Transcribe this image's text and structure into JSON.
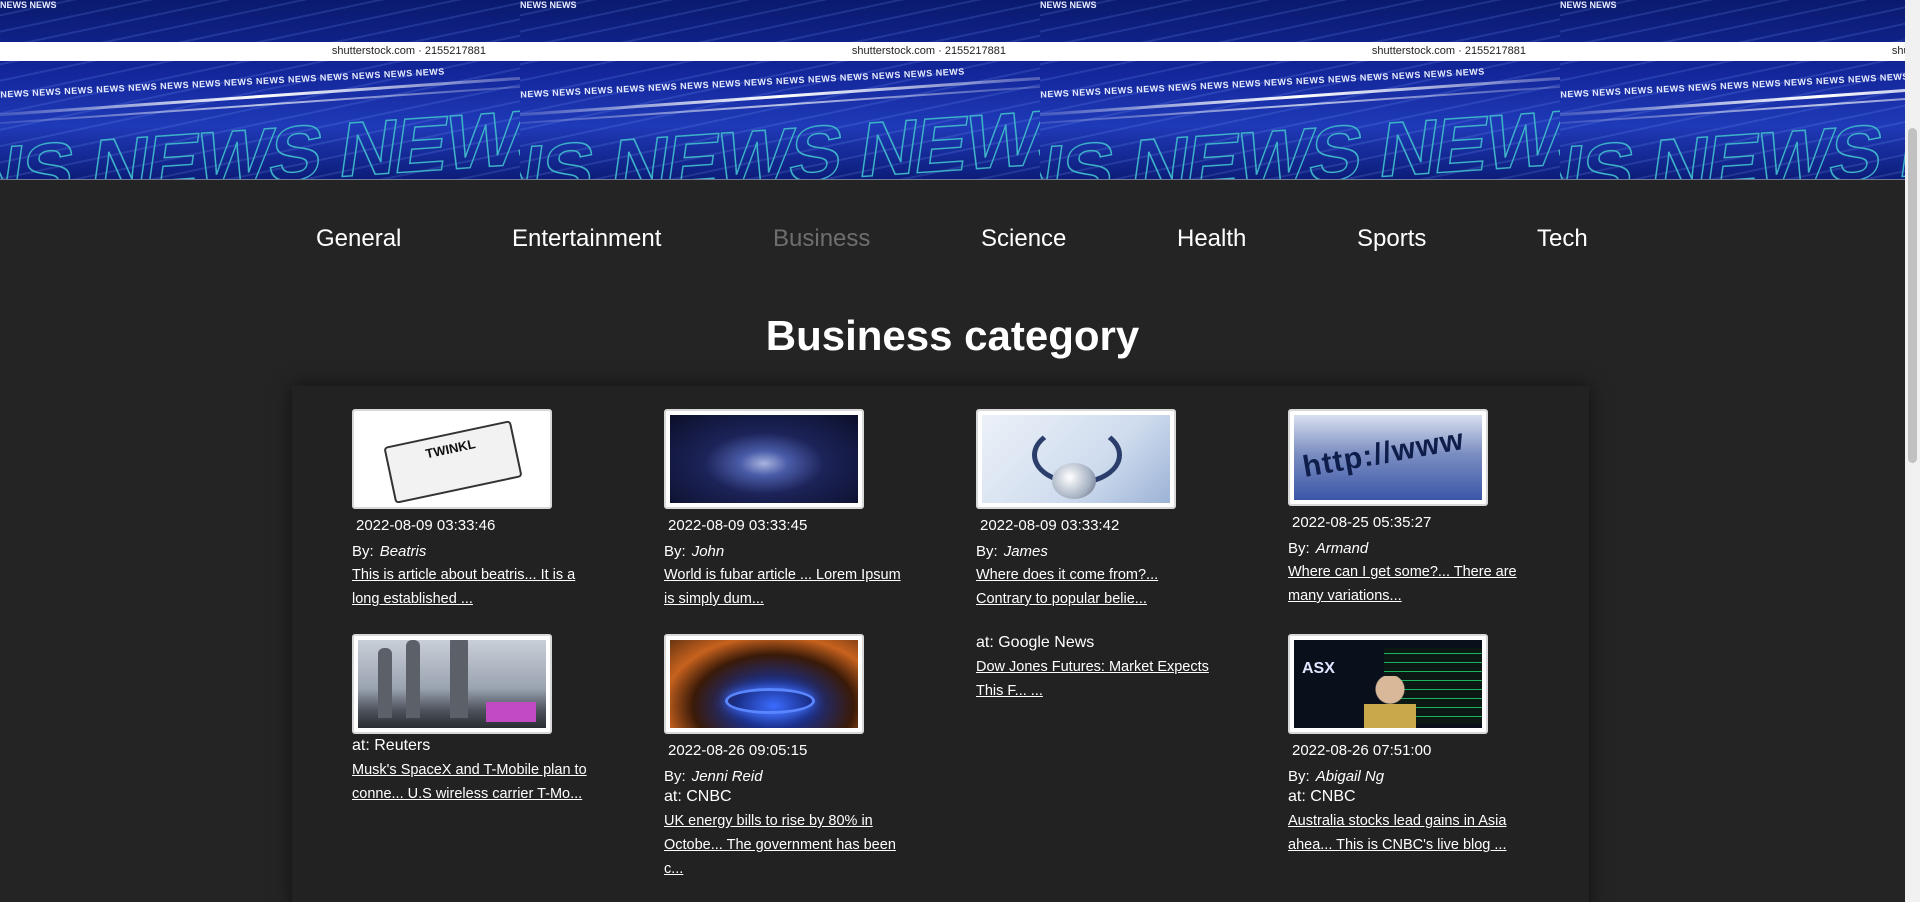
{
  "banner": {
    "watermark": "shutterstock.com · 2155217881",
    "word": "NEWS"
  },
  "nav": {
    "items": [
      "General",
      "Entertainment",
      "Business",
      "Science",
      "Health",
      "Sports",
      "Tech"
    ],
    "active": "Business"
  },
  "heading": "Business category",
  "articles": [
    {
      "image": "newspaper-image",
      "image_text": "TWINKL",
      "date": "2022-08-09 03:33:46",
      "by_label": "By:",
      "author": "Beatris",
      "source": "",
      "desc": "This is article about beatris... It is a long established ..."
    },
    {
      "image": "night-sky-image",
      "date": "2022-08-09 03:33:45",
      "by_label": "By:",
      "author": "John",
      "source": "",
      "desc": "World is fubar article ... Lorem Ipsum is simply dum..."
    },
    {
      "image": "stethoscope-image",
      "date": "2022-08-09 03:33:42",
      "by_label": "By:",
      "author": "James",
      "source": "",
      "desc": "Where does it come from?... Contrary to popular belie..."
    },
    {
      "image": "http-image",
      "image_text": "http://www",
      "date": "2022-08-25 05:35:27",
      "by_label": "By:",
      "author": "Armand",
      "source": "",
      "desc": "Where can I get some?... There are many variations..."
    },
    {
      "image": "rockets-image",
      "date": "",
      "author": "",
      "source": "at: Reuters",
      "desc": "Musk's SpaceX and T-Mobile plan to conne... U.S wireless carrier T-Mo..."
    },
    {
      "image": "gas-stove-image",
      "date": "2022-08-26 09:05:15",
      "by_label": "By:",
      "author": "Jenni Reid",
      "source": "at: CNBC",
      "desc": "UK energy bills to rise by 80% in Octobe... The government has been c..."
    },
    {
      "image": "",
      "date": "",
      "author": "",
      "source": "at: Google News",
      "desc": "Dow Jones Futures: Market Expects This F... ..."
    },
    {
      "image": "asx-trader-image",
      "image_text": "ASX",
      "date": "2022-08-26 07:51:00",
      "by_label": "By:",
      "author": "Abigail Ng",
      "source": "at: CNBC",
      "desc": "Australia stocks lead gains in Asia ahea... This is CNBC's live blog ..."
    }
  ],
  "colors": {
    "background": "#242424",
    "panel": "#222222",
    "active_nav": "#6e6e6e",
    "banner_blue": "#13269a"
  }
}
